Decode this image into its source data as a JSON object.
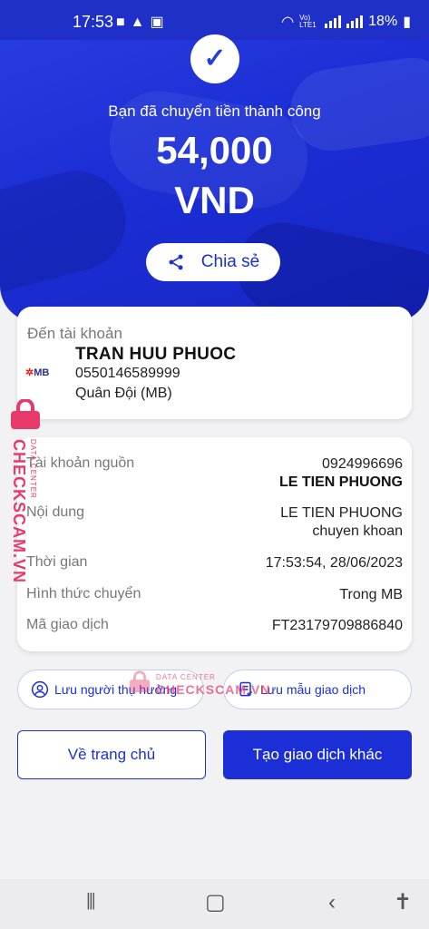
{
  "status_bar": {
    "time": "17:53",
    "left_icons": [
      "camera-icon",
      "warning-icon",
      "square-icon"
    ],
    "network_label": "Vo) LTE1",
    "battery": "18%"
  },
  "hero": {
    "message": "Bạn đã chuyển tiền thành công",
    "amount": "54,000",
    "currency": "VND",
    "share_label": "Chia sẻ"
  },
  "destination": {
    "label": "Đến tài khoản",
    "bank_logo": "MB",
    "name": "TRAN HUU PHUOC",
    "account_number": "0550146589999",
    "bank_name": "Quân Đội (MB)"
  },
  "details": {
    "rows": [
      {
        "label": "Tài khoản nguồn",
        "value": "0924996696",
        "value2": "LE TIEN PHUONG"
      },
      {
        "label": "Nội dung",
        "value": "LE TIEN PHUONG",
        "value2": "chuyen khoan"
      },
      {
        "label": "Thời gian",
        "value": "17:53:54, 28/06/2023"
      },
      {
        "label": "Hình thức chuyển",
        "value": "Trong MB"
      },
      {
        "label": "Mã giao dịch",
        "value": "FT23179709886840"
      }
    ]
  },
  "actions": {
    "save_recipient": "Lưu người thụ hưởng",
    "save_template": "Lưu mẫu giao dịch",
    "home": "Về trang chủ",
    "new_transaction": "Tạo giao dịch khác"
  },
  "watermark": {
    "vertical_text": "CHECKSCAM.VN",
    "vertical_sub": "DATA CENTER",
    "center_sub": "DATA CENTER",
    "center_text": "CHECKSCAM.VN"
  },
  "colors": {
    "brand_blue": "#1c2fd6",
    "watermark_pink": "#e83a6a"
  }
}
